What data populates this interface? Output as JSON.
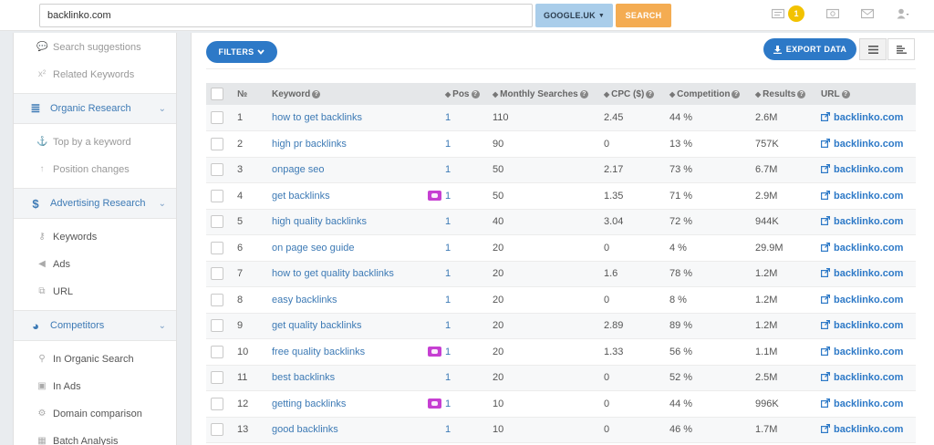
{
  "search": {
    "value": "backlinko.com",
    "placeholder": ""
  },
  "database": {
    "label": "GOOGLE.UK"
  },
  "search_button": {
    "label": "SEARCH"
  },
  "notifications": {
    "count": "1"
  },
  "sidebar": {
    "items": [
      {
        "label": "Search suggestions",
        "icon": "speech-bubbles-icon",
        "muted": true
      },
      {
        "label": "Related Keywords",
        "icon": "superscript-x2-icon",
        "muted": true
      }
    ],
    "sections": [
      {
        "label": "Organic Research",
        "icon": "database-icon",
        "items": [
          {
            "label": "Top by a keyword",
            "icon": "anchor-icon"
          },
          {
            "label": "Position changes",
            "icon": "arrow-up-icon"
          }
        ]
      },
      {
        "label": "Advertising Research",
        "icon": "dollar-icon",
        "items": [
          {
            "label": "Keywords",
            "icon": "key-icon"
          },
          {
            "label": "Ads",
            "icon": "megaphone-icon"
          },
          {
            "label": "URL",
            "icon": "link-icon"
          }
        ]
      },
      {
        "label": "Competitors",
        "icon": "pie-chart-icon",
        "items": [
          {
            "label": "In Organic Search",
            "icon": "magnifier-icon"
          },
          {
            "label": "In Ads",
            "icon": "money-icon"
          },
          {
            "label": "Domain comparison",
            "icon": "cogs-icon"
          },
          {
            "label": "Batch Analysis",
            "icon": "grid-icon"
          }
        ]
      }
    ]
  },
  "toolbar": {
    "filters_label": "FILTERS",
    "export_label": "EXPORT DATA"
  },
  "table": {
    "headers": {
      "no": "№",
      "keyword": "Keyword",
      "pos": "Pos",
      "monthly": "Monthly Searches",
      "cpc": "CPC ($)",
      "competition": "Competition",
      "results": "Results",
      "url": "URL"
    },
    "rows": [
      {
        "n": "1",
        "keyword": "how to get backlinks",
        "pos": "1",
        "searches": "110",
        "cpc": "2.45",
        "competition": "44 %",
        "results": "2.6M",
        "url": "backlinko.com",
        "comment": false
      },
      {
        "n": "2",
        "keyword": "high pr backlinks",
        "pos": "1",
        "searches": "90",
        "cpc": "0",
        "competition": "13 %",
        "results": "757K",
        "url": "backlinko.com",
        "comment": false
      },
      {
        "n": "3",
        "keyword": "onpage seo",
        "pos": "1",
        "searches": "50",
        "cpc": "2.17",
        "competition": "73 %",
        "results": "6.7M",
        "url": "backlinko.com",
        "comment": false
      },
      {
        "n": "4",
        "keyword": "get backlinks",
        "pos": "1",
        "searches": "50",
        "cpc": "1.35",
        "competition": "71 %",
        "results": "2.9M",
        "url": "backlinko.com",
        "comment": true
      },
      {
        "n": "5",
        "keyword": "high quality backlinks",
        "pos": "1",
        "searches": "40",
        "cpc": "3.04",
        "competition": "72 %",
        "results": "944K",
        "url": "backlinko.com",
        "comment": false
      },
      {
        "n": "6",
        "keyword": "on page seo guide",
        "pos": "1",
        "searches": "20",
        "cpc": "0",
        "competition": "4 %",
        "results": "29.9M",
        "url": "backlinko.com",
        "comment": false
      },
      {
        "n": "7",
        "keyword": "how to get quality backlinks",
        "pos": "1",
        "searches": "20",
        "cpc": "1.6",
        "competition": "78 %",
        "results": "1.2M",
        "url": "backlinko.com",
        "comment": false
      },
      {
        "n": "8",
        "keyword": "easy backlinks",
        "pos": "1",
        "searches": "20",
        "cpc": "0",
        "competition": "8 %",
        "results": "1.2M",
        "url": "backlinko.com",
        "comment": false
      },
      {
        "n": "9",
        "keyword": "get quality backlinks",
        "pos": "1",
        "searches": "20",
        "cpc": "2.89",
        "competition": "89 %",
        "results": "1.2M",
        "url": "backlinko.com",
        "comment": false
      },
      {
        "n": "10",
        "keyword": "free quality backlinks",
        "pos": "1",
        "searches": "20",
        "cpc": "1.33",
        "competition": "56 %",
        "results": "1.1M",
        "url": "backlinko.com",
        "comment": true
      },
      {
        "n": "11",
        "keyword": "best backlinks",
        "pos": "1",
        "searches": "20",
        "cpc": "0",
        "competition": "52 %",
        "results": "2.5M",
        "url": "backlinko.com",
        "comment": false
      },
      {
        "n": "12",
        "keyword": "getting backlinks",
        "pos": "1",
        "searches": "10",
        "cpc": "0",
        "competition": "44 %",
        "results": "996K",
        "url": "backlinko.com",
        "comment": true
      },
      {
        "n": "13",
        "keyword": "good backlinks",
        "pos": "1",
        "searches": "10",
        "cpc": "0",
        "competition": "46 %",
        "results": "1.7M",
        "url": "backlinko.com",
        "comment": false
      }
    ]
  },
  "colors": {
    "accent": "#2d79c7",
    "link": "#3d7ab5",
    "search_button": "#f4ac52",
    "database_button": "#a9cdea",
    "badge": "#f2c200",
    "comment": "#c63fd2"
  }
}
